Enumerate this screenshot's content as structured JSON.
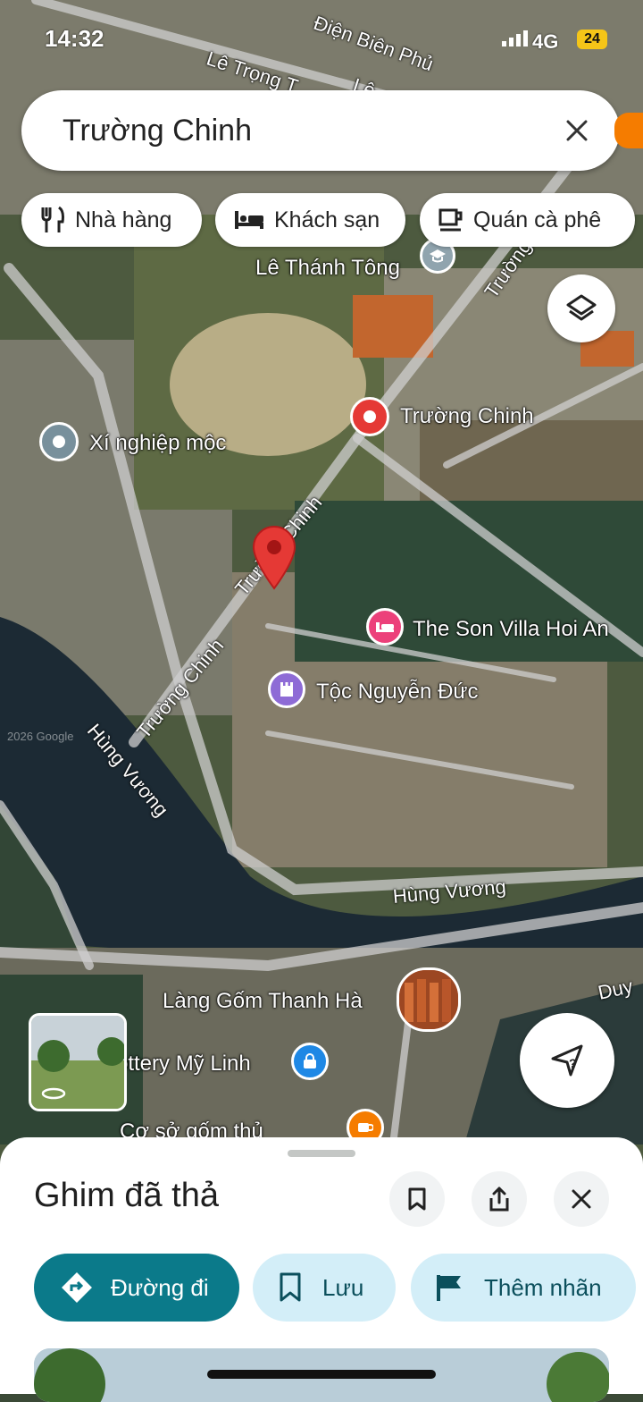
{
  "status": {
    "time": "14:32",
    "network": "4G",
    "battery": "24"
  },
  "search": {
    "query": "Trường Chinh",
    "clear_icon": "close-icon"
  },
  "chips": [
    {
      "label": "Nhà hàng",
      "icon": "restaurant-icon"
    },
    {
      "label": "Khách sạn",
      "icon": "hotel-icon"
    },
    {
      "label": "Quán cà phê",
      "icon": "coffee-icon"
    }
  ],
  "map": {
    "places": {
      "le_thanh_tong": "Lê Thánh Tông",
      "truong_chinh_poi": "Trường Chinh",
      "xi_nghiep_moc": "Xí nghiệp mộc",
      "son_villa": "The Son Villa Hoi An",
      "toc_nguyen_duc": "Tộc Nguyễn Đức",
      "lang_gom": "Làng Gốm Thanh Hà",
      "pottery": "ottery Mỹ Linh",
      "co_so_gom": "Cơ sở gốm thủ"
    },
    "roads": {
      "dien_bien_phu": "Điện Biên Phủ",
      "le_trong": "Lê Trọng T",
      "le": "Lê",
      "truong_chinh_a": "Trường Chinh",
      "truong_chinh_b": "Trường Chinh",
      "truong_chinh_c": "Trường",
      "hung_vuong_a": "Hùng Vương",
      "hung_vuong_b": "Hùng Vương",
      "duy": "Duy"
    },
    "watermark": "2026 Google"
  },
  "sheet": {
    "title": "Ghim đã thả",
    "actions": {
      "directions": "Đường đi",
      "save": "Lưu",
      "label": "Thêm nhãn"
    }
  },
  "colors": {
    "accent": "#0b7a8a",
    "pin_red": "#e53935",
    "chip_light": "#d3eef8"
  }
}
